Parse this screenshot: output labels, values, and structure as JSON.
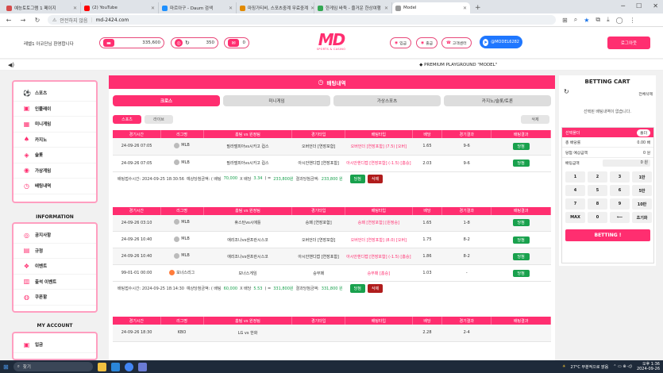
{
  "browser": {
    "tabs": [
      {
        "title": "예능토토그램 1 페이지",
        "color": "#d64b4b"
      },
      {
        "title": "(2) YouTube",
        "color": "#ff0000"
      },
      {
        "title": "마르아구 - Daum 검색",
        "color": "#1e90ff"
      },
      {
        "title": "마징가티비, 스포츠중계 무료중계",
        "color": "#e28a00"
      },
      {
        "title": "한게임 바둑 - 즐거운 한상여행",
        "color": "#34a853"
      },
      {
        "title": "Model",
        "color": "#999999"
      }
    ],
    "url_warning": "안전하지 않음",
    "url": "md-2424.com"
  },
  "header": {
    "welcome": "레벨1 아코단님 환영합니다",
    "wallet_value": "335,600",
    "point_value": "350",
    "message_value": "0",
    "logo_text": "MD",
    "logo_sub": "SPORTS & CASINO",
    "deposit_label": "입금",
    "withdraw_label": "출금",
    "support_label": "고객센터",
    "telegram_label": "@MODEL6282",
    "logout_label": "로그아웃"
  },
  "marquee": "◆ PREMIUM PLAYGROUND \"MODEL\"",
  "sidebar": {
    "menu": [
      {
        "label": "스포츠",
        "icon": "⚽"
      },
      {
        "label": "인플레이",
        "icon": "▣"
      },
      {
        "label": "미니게임",
        "icon": "▦"
      },
      {
        "label": "카지노",
        "icon": "♠"
      },
      {
        "label": "슬롯",
        "icon": "◈"
      },
      {
        "label": "가상게임",
        "icon": "◉"
      },
      {
        "label": "배팅내역",
        "icon": "◷"
      }
    ],
    "info_title": "INFORMATION",
    "info": [
      {
        "label": "공지사항",
        "icon": "◎"
      },
      {
        "label": "규정",
        "icon": "▤"
      },
      {
        "label": "이벤트",
        "icon": "❖"
      },
      {
        "label": "출석 이벤트",
        "icon": "▥"
      },
      {
        "label": "쿠폰함",
        "icon": "◍"
      }
    ],
    "account_title": "MY ACCOUNT",
    "account": [
      {
        "label": "입금",
        "icon": "▣"
      }
    ]
  },
  "main": {
    "title": "배팅내역",
    "category_tabs": [
      "크로스",
      "미니게임",
      "가상스포츠",
      "카지노/슬롯/토론"
    ],
    "sub_tabs": [
      "스포츠",
      "라이브"
    ],
    "delete_label": "삭제",
    "columns": [
      "경기시간",
      "리그명",
      "홈팀 vs 원정팀",
      "경기타입",
      "배팅타입",
      "배당",
      "경기결과",
      "배팅결과"
    ],
    "slips": [
      {
        "rows": [
          {
            "time": "24-09-26 07:05",
            "league": "MLB",
            "match": "필라델피아vs시카고 컵스",
            "type": "오버언더 [연장포함]",
            "bet": "오버언더 [연장포함] (7.5) [오버]",
            "odds": "1.65",
            "score": "9-6",
            "result": "당첨"
          },
          {
            "time": "24-09-26 07:05",
            "league": "MLB",
            "match": "필라델피아vs시카고 컵스",
            "type": "아시안핸디캡 [연장포함]",
            "bet": "아시안핸디캡 [연장포함] (-1.5) [홈승]",
            "odds": "2.03",
            "score": "9-6",
            "result": "당첨"
          }
        ],
        "summary": {
          "time_label": "배팅접수시간: 2024-09-25 18:30:56",
          "expected_label": "예상당첨금액: ( 배팅",
          "stake": "70,000",
          "x": "X 배당",
          "odds": "3.34",
          "close": ") =",
          "expected": "233,800원",
          "payout_label": "결과당첨금액:",
          "payout": "233,800 원",
          "win": "당첨",
          "delete": "삭제"
        }
      },
      {
        "rows": [
          {
            "time": "24-09-26 03:10",
            "league": "MLB",
            "match": "휴스턴vs시애틀",
            "type": "승패 [연장포함]",
            "bet": "승패 [연장포함] [원정승]",
            "odds": "1.65",
            "score": "1-8",
            "result": "당첨"
          },
          {
            "time": "24-09-26 10:40",
            "league": "MLB",
            "match": "애리조나vs샌프란시스코",
            "type": "오버언더 [연장포함]",
            "bet": "오버언더 [연장포함] (8.0) [오버]",
            "odds": "1.75",
            "score": "8-2",
            "result": "당첨"
          },
          {
            "time": "24-09-26 10:40",
            "league": "MLB",
            "match": "애리조나vs샌프란시스코",
            "type": "아시안핸디캡 [연장포함]",
            "bet": "아시안핸디캡 [연장포함] (-1.5) [홈승]",
            "odds": "1.86",
            "score": "8-2",
            "result": "당첨"
          },
          {
            "time": "99-01-01 00:00",
            "league": "보너스리그",
            "match": "보너스게임",
            "type": "승무패",
            "bet": "승무패 [홈승]",
            "odds": "1.03",
            "score": "-",
            "result": "당첨"
          }
        ],
        "summary": {
          "time_label": "배팅접수시간: 2024-09-25 18:14:30",
          "expected_label": "예상당첨금액: ( 배팅",
          "stake": "60,000",
          "x": "X 배당",
          "odds": "5.53",
          "close": ") =",
          "expected": "331,800원",
          "payout_label": "결과당첨금액:",
          "payout": "331,800 원",
          "win": "당첨",
          "delete": "삭제"
        }
      }
    ],
    "partial_row": {
      "time": "24-09-26 18:30",
      "league": "KBO",
      "match": "LG vs 한화",
      "odds": "2.28",
      "score": "2-4"
    }
  },
  "cart": {
    "title": "BETTING CART",
    "clear_label": "전체삭제",
    "empty_msg": "선택된 배팅내역이 없습니다.",
    "bar_label": "선택폴더",
    "bar_right": "폴더",
    "total_odds_label": "총 배당률",
    "total_odds": "0.00 배",
    "expected_label": "당첨 예상금액",
    "expected_value": "0 원",
    "amount_label": "배팅금액",
    "amount_value": "0 원",
    "keys": [
      "1",
      "2",
      "3",
      "1만",
      "4",
      "5",
      "6",
      "5만",
      "7",
      "8",
      "9",
      "10만",
      "MAX",
      "0",
      "⟵",
      "초기화"
    ],
    "bet_button": "BETTING !"
  },
  "taskbar": {
    "search": "찾기",
    "weather": "27°C 부분적으로 맑음",
    "time": "오후 1:36",
    "date": "2024-09-26"
  }
}
